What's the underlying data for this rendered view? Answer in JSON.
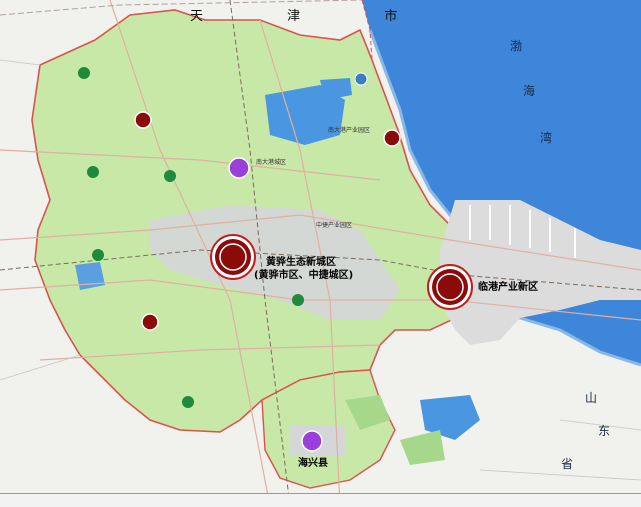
{
  "map": {
    "region_labels": {
      "tianjin": "天 津 市",
      "bohai_1": "渤",
      "bohai_2": "海",
      "bohai_3": "湾",
      "shandong_1": "山",
      "shandong_2": "东",
      "shandong_3": "省"
    },
    "zones": {
      "huanghua_new_city": "黄骅生态新城区",
      "huanghua_new_city_sub": "(黄骅市区、中捷城区)",
      "lingang_new_area": "临港产业新区",
      "haixing_county": "海兴县",
      "nandagang_city": "南大港城区",
      "zhongjie_industrial": "中捷产业园区",
      "nandagang_industrial": "南大港产业园区"
    },
    "marker_legend": {
      "dark_red": "#8b0a0a",
      "purple": "#9b3fdb",
      "green": "#1f8a3a",
      "blue": "#3a7fc4"
    },
    "colors": {
      "sea": "#3e86d9",
      "land_plan": "#c8e8a8",
      "outside": "#f1f1ee",
      "urban": "#d5d6d8",
      "boundary": "#d9534f"
    }
  }
}
